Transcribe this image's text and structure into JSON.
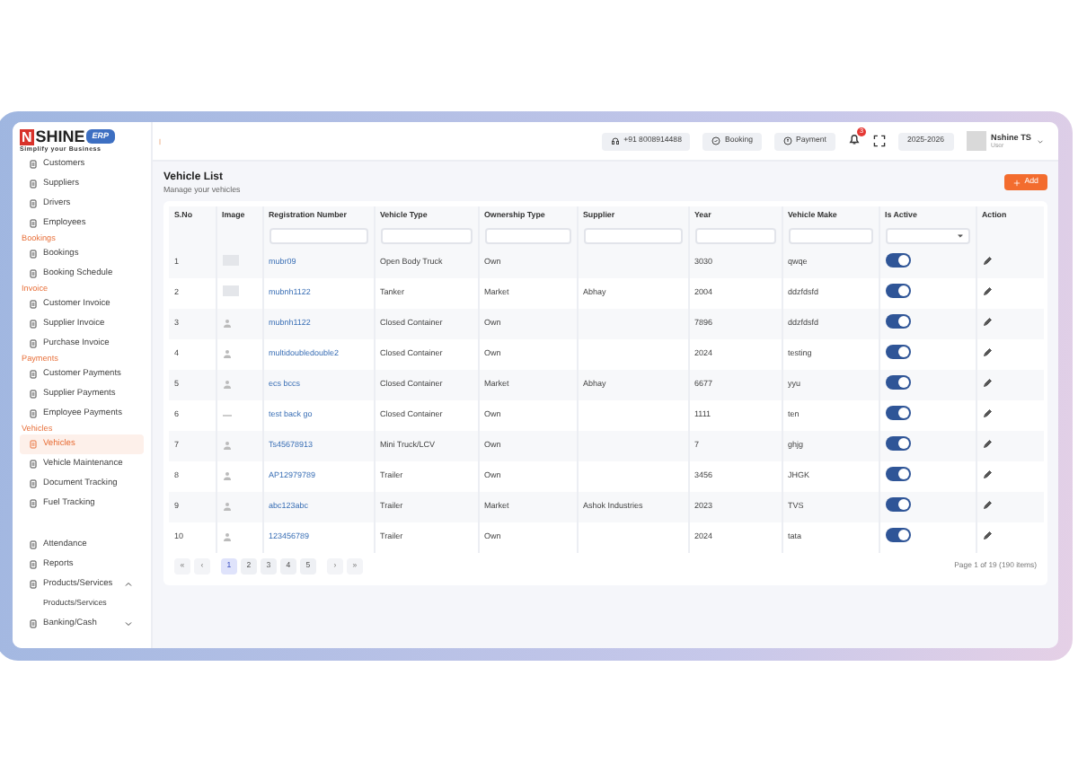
{
  "logo": {
    "mark": "N",
    "name": "SHINE",
    "badge": "ERP",
    "tagline": "Simplify your Business"
  },
  "sidebar": {
    "sections": [
      {
        "items": [
          {
            "label": "Customers",
            "selected": false
          },
          {
            "label": "Suppliers",
            "selected": false
          },
          {
            "label": "Drivers",
            "selected": false
          },
          {
            "label": "Employees",
            "selected": false
          }
        ]
      },
      {
        "heading": "Bookings",
        "items": [
          {
            "label": "Bookings",
            "selected": false
          },
          {
            "label": "Booking Schedule",
            "selected": false
          }
        ]
      },
      {
        "heading": "Invoice",
        "items": [
          {
            "label": "Customer Invoice",
            "selected": false
          },
          {
            "label": "Supplier Invoice",
            "selected": false
          },
          {
            "label": "Purchase Invoice",
            "selected": false
          }
        ]
      },
      {
        "heading": "Payments",
        "items": [
          {
            "label": "Customer Payments",
            "selected": false
          },
          {
            "label": "Supplier Payments",
            "selected": false
          },
          {
            "label": "Employee Payments",
            "selected": false
          }
        ]
      },
      {
        "heading": "Vehicles",
        "items": [
          {
            "label": "Vehicles",
            "selected": true
          },
          {
            "label": "Vehicle Maintenance",
            "selected": false
          },
          {
            "label": "Document Tracking",
            "selected": false
          },
          {
            "label": "Fuel Tracking",
            "selected": false
          }
        ]
      },
      {
        "items": [
          {
            "label": "Attendance",
            "selected": false
          },
          {
            "label": "Reports",
            "selected": false
          },
          {
            "label": "Products/Services",
            "selected": false,
            "expanded": true,
            "children": [
              {
                "label": "Products/Services",
                "selected": false
              }
            ]
          },
          {
            "label": "Banking/Cash",
            "selected": false,
            "expanded": false
          }
        ]
      }
    ]
  },
  "topbar": {
    "buttons": [
      {
        "kind": "phone",
        "label": "+91 8008914488"
      },
      {
        "kind": "booking",
        "label": "Booking"
      },
      {
        "kind": "payment",
        "label": "Payment"
      }
    ],
    "notification_count": "3",
    "fiscal_year": "2025-2026",
    "user": {
      "name": "Nshine TS",
      "role": "User"
    }
  },
  "page": {
    "title": "Vehicle List",
    "subtitle": "Manage your vehicles",
    "add_button": "Add"
  },
  "table": {
    "columns": [
      {
        "label": "S.No"
      },
      {
        "label": "Image"
      },
      {
        "label": "Registration Number"
      },
      {
        "label": "Vehicle Type"
      },
      {
        "label": "Ownership Type"
      },
      {
        "label": "Supplier"
      },
      {
        "label": "Year"
      },
      {
        "label": "Vehicle Make"
      },
      {
        "label": "Is Active"
      },
      {
        "label": "Action"
      }
    ],
    "filters": [
      {
        "kind": "none"
      },
      {
        "kind": "none"
      },
      {
        "kind": "text"
      },
      {
        "kind": "text"
      },
      {
        "kind": "text"
      },
      {
        "kind": "text"
      },
      {
        "kind": "text"
      },
      {
        "kind": "text"
      },
      {
        "kind": "select"
      },
      {
        "kind": "none"
      }
    ],
    "rows": [
      {
        "sno": "1",
        "image": {
          "kind": "photo"
        },
        "registration": "mubr09",
        "type": "Open Body Truck",
        "ownership": "Own",
        "supplier": "",
        "year": "3030",
        "make": "qwqe",
        "active": true
      },
      {
        "sno": "2",
        "image": {
          "kind": "photo"
        },
        "registration": "mubnh1122",
        "type": "Tanker",
        "ownership": "Market",
        "supplier": "Abhay",
        "year": "2004",
        "make": "ddzfdsfd",
        "active": true
      },
      {
        "sno": "3",
        "image": {
          "kind": "avatar"
        },
        "registration": "mubnh1122",
        "type": "Closed Container",
        "ownership": "Own",
        "supplier": "",
        "year": "7896",
        "make": "ddzfdsfd",
        "active": true
      },
      {
        "sno": "4",
        "image": {
          "kind": "avatar"
        },
        "registration": "multidoubledouble2",
        "type": "Closed Container",
        "ownership": "Own",
        "supplier": "",
        "year": "2024",
        "make": "testing",
        "active": true
      },
      {
        "sno": "5",
        "image": {
          "kind": "avatar"
        },
        "registration": "ecs bccs",
        "type": "Closed Container",
        "ownership": "Market",
        "supplier": "Abhay",
        "year": "6677",
        "make": "yyu",
        "active": true
      },
      {
        "sno": "6",
        "image": {
          "kind": "broken"
        },
        "registration": "test back go",
        "type": "Closed Container",
        "ownership": "Own",
        "supplier": "",
        "year": "1111",
        "make": "ten",
        "active": true
      },
      {
        "sno": "7",
        "image": {
          "kind": "avatar"
        },
        "registration": "Ts45678913",
        "type": "Mini Truck/LCV",
        "ownership": "Own",
        "supplier": "",
        "year": "7",
        "make": "ghjg",
        "active": true
      },
      {
        "sno": "8",
        "image": {
          "kind": "avatar"
        },
        "registration": "AP12979789",
        "type": "Trailer",
        "ownership": "Own",
        "supplier": "",
        "year": "3456",
        "make": "JHGK",
        "active": true
      },
      {
        "sno": "9",
        "image": {
          "kind": "avatar"
        },
        "registration": "abc123abc",
        "type": "Trailer",
        "ownership": "Market",
        "supplier": "Ashok Industries",
        "year": "2023",
        "make": "TVS",
        "active": true
      },
      {
        "sno": "10",
        "image": {
          "kind": "avatar"
        },
        "registration": "123456789",
        "type": "Trailer",
        "ownership": "Own",
        "supplier": "",
        "year": "2024",
        "make": "tata",
        "active": true
      }
    ]
  },
  "pagination": {
    "pages": [
      {
        "label": "«",
        "kind": "first",
        "selected": false
      },
      {
        "label": "‹",
        "kind": "prev",
        "selected": false
      },
      {
        "label": "1",
        "kind": "page",
        "selected": true
      },
      {
        "label": "2",
        "kind": "page",
        "selected": false
      },
      {
        "label": "3",
        "kind": "page",
        "selected": false
      },
      {
        "label": "4",
        "kind": "page",
        "selected": false
      },
      {
        "label": "5",
        "kind": "page",
        "selected": false
      },
      {
        "label": "›",
        "kind": "next",
        "selected": false
      },
      {
        "label": "»",
        "kind": "last",
        "selected": false
      }
    ],
    "summary": "Page 1 of 19 (190 items)"
  }
}
